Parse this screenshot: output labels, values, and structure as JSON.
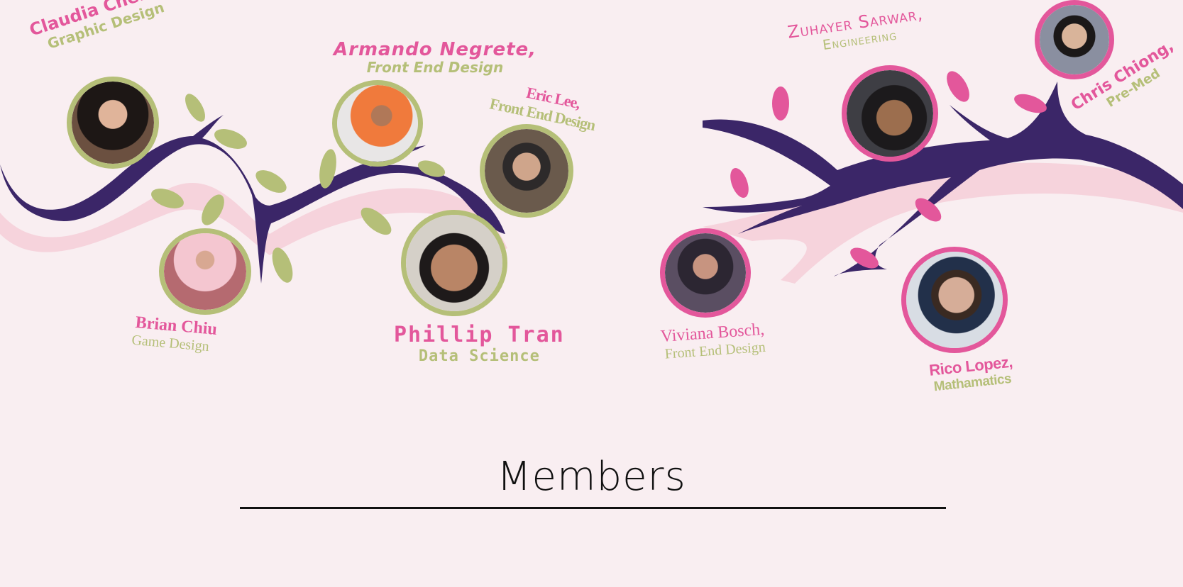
{
  "section": {
    "title": "Members"
  },
  "colors": {
    "background": "#f9eef1",
    "branch": "#3b2668",
    "pink": "#e3579b",
    "green": "#b5bf78",
    "shadow": "#f5cfd9"
  },
  "members": [
    {
      "id": "claudia",
      "name": "Claudia Chen,",
      "role": "Graphic Design"
    },
    {
      "id": "armando",
      "name": "Armando Negrete,",
      "role": "Front End Design"
    },
    {
      "id": "eric",
      "name": "Eric Lee,",
      "role": "Front End Design"
    },
    {
      "id": "brian",
      "name": "Brian Chiu",
      "role": "Game Design"
    },
    {
      "id": "phillip",
      "name": "Phillip Tran",
      "role": "Data Science"
    },
    {
      "id": "zuhayer",
      "name": "Zuhayer Sarwar,",
      "role": "Engineering"
    },
    {
      "id": "chris",
      "name": "Chris Chiong,",
      "role": "Pre-Med"
    },
    {
      "id": "viviana",
      "name": "Viviana Bosch,",
      "role": "Front End Design"
    },
    {
      "id": "rico",
      "name": "Rico Lopez,",
      "role": "Mathamatics"
    }
  ]
}
